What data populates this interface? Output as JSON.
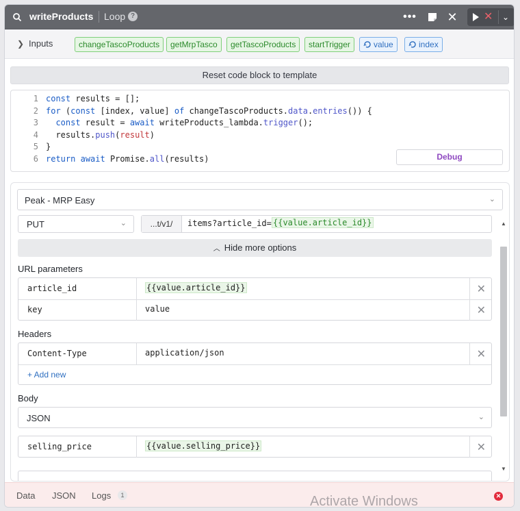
{
  "header": {
    "title": "writeProducts",
    "subtitle": "Loop",
    "help_icon": "question-circle-icon"
  },
  "inputs": {
    "label": "Inputs",
    "chips": [
      {
        "label": "changeTascoProducts",
        "kind": "green"
      },
      {
        "label": "getMrpTasco",
        "kind": "green"
      },
      {
        "label": "getTascoProducts",
        "kind": "green"
      },
      {
        "label": "startTrigger",
        "kind": "green"
      },
      {
        "label": "value",
        "kind": "blue"
      },
      {
        "label": "index",
        "kind": "blue"
      }
    ]
  },
  "reset_label": "Reset code block to template",
  "code": {
    "line_numbers": [
      "1",
      "2",
      "3",
      "4",
      "5",
      "6"
    ],
    "lines": [
      "const results = [];",
      "for (const [index, value] of changeTascoProducts.data.entries()) {",
      "  const result = await writeProducts_lambda.trigger();",
      "  results.push(result)",
      "}",
      "return await Promise.all(results)"
    ],
    "debug_label": "Debug"
  },
  "resource": {
    "name": "Peak - MRP Easy",
    "method": "PUT",
    "url_prefix": "...t/v1/",
    "url_path": "items?article_id=",
    "url_template": "{{value.article_id}}",
    "hide_options_label": "Hide more options",
    "url_params_label": "URL parameters",
    "url_params": [
      {
        "key": "article_id",
        "value": "{{value.article_id}}"
      }
    ],
    "url_param_placeholder": {
      "key": "key",
      "value": "value"
    },
    "headers_label": "Headers",
    "headers": [
      {
        "key": "Content-Type",
        "value": "application/json"
      }
    ],
    "add_new_label": "+ Add new",
    "body_label": "Body",
    "body_type": "JSON",
    "body_rows": [
      {
        "key": "selling_price",
        "value": "{{value.selling_price}}"
      }
    ]
  },
  "footer": {
    "tabs": [
      "Data",
      "JSON",
      "Logs"
    ],
    "logs_count": "1"
  },
  "watermark": "Activate Windows"
}
